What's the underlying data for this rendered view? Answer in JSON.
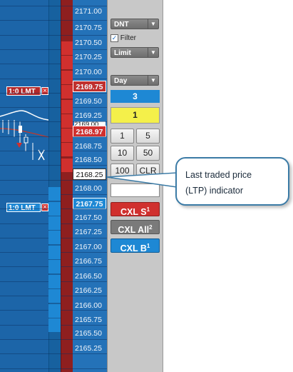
{
  "prices": [
    "2171.00",
    "2170.75",
    "2170.50",
    "2170.25",
    "2170.00",
    "2169.75",
    "2169.50",
    "2169.25",
    "2169.00",
    "2168.97",
    "2168.75",
    "2168.50",
    "2168.25",
    "2168.00",
    "2167.75",
    "2167.50",
    "2167.25",
    "2167.00",
    "2166.75",
    "2166.50",
    "2166.25",
    "2166.00",
    "2165.75",
    "2165.50",
    "2165.25"
  ],
  "highlight": {
    "sell_order_price": "2169.75",
    "current_price": "2168.97",
    "ltp_price": "2168.25",
    "buy_order_price": "2167.75"
  },
  "orders": {
    "sell_label_qty": "1:0",
    "sell_label_type": "LMT",
    "buy_label_qty": "1:0",
    "buy_label_type": "LMT",
    "cancel_glyph": "×"
  },
  "panel": {
    "account": "DNT",
    "filter_label": "Filter",
    "filter_checked": true,
    "order_type": "Limit",
    "tif": "Day",
    "quantity_display": "3",
    "quantity_input": "1",
    "qty_buttons": [
      "1",
      "5",
      "10",
      "50",
      "100",
      "CLR"
    ],
    "price_input": "",
    "cxl_sell_label": "CXL S",
    "cxl_sell_count": "1",
    "cxl_all_label": "CXL All",
    "cxl_all_count": "2",
    "cxl_buy_label": "CXL B",
    "cxl_buy_count": "1"
  },
  "callout": {
    "line1": "Last traded price",
    "line2": "(LTP) indicator"
  },
  "colors": {
    "sell": "#d0302e",
    "buy": "#1e88d4",
    "ltp_box": "#ffffff",
    "callout_border": "#3b7ba6"
  }
}
